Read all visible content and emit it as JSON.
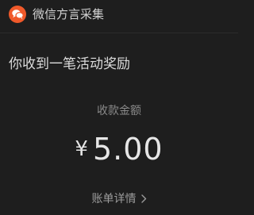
{
  "header": {
    "app_name": "微信方言采集",
    "app_icon": "chat-bubbles-icon",
    "icon_color": "#f0592a"
  },
  "message": {
    "text": "你收到一笔活动奖励"
  },
  "payment": {
    "label": "收款金额",
    "currency": "¥",
    "amount": "5.00"
  },
  "footer": {
    "details_label": "账单详情",
    "details_icon": "chevron-right-icon"
  }
}
